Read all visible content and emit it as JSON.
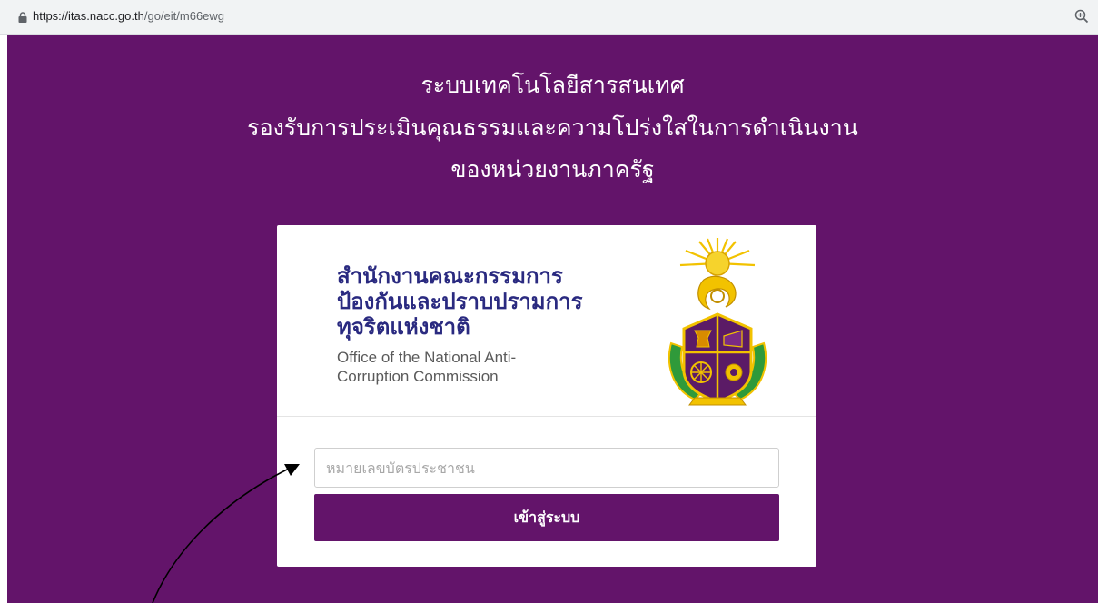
{
  "browser": {
    "url_host": "https://itas.nacc.go.th",
    "url_path": "/go/eit/m66ewg"
  },
  "header": {
    "line1": "ระบบเทคโนโลยีสารสนเทศ",
    "line2": "รองรับการประเมินคุณธรรมและความโปร่งใสในการดำเนินงาน",
    "line3": "ของหน่วยงานภาครัฐ"
  },
  "card": {
    "org_name_th_line1": "สำนักงานคณะกรรมการ",
    "org_name_th_line2": "ป้องกันและปราบปรามการ",
    "org_name_th_line3": "ทุจริตแห่งชาติ",
    "org_name_en_line1": "Office of the National Anti-",
    "org_name_en_line2": "Corruption Commission",
    "id_input_placeholder": "หมายเลขบัตรประชาชน",
    "login_label": "เข้าสู่ระบบ"
  },
  "colors": {
    "brand_purple": "#63146a",
    "org_text": "#2a2a80"
  },
  "icons": {
    "lock": "lock-icon",
    "zoom": "zoom-icon",
    "emblem": "nacc-emblem"
  }
}
